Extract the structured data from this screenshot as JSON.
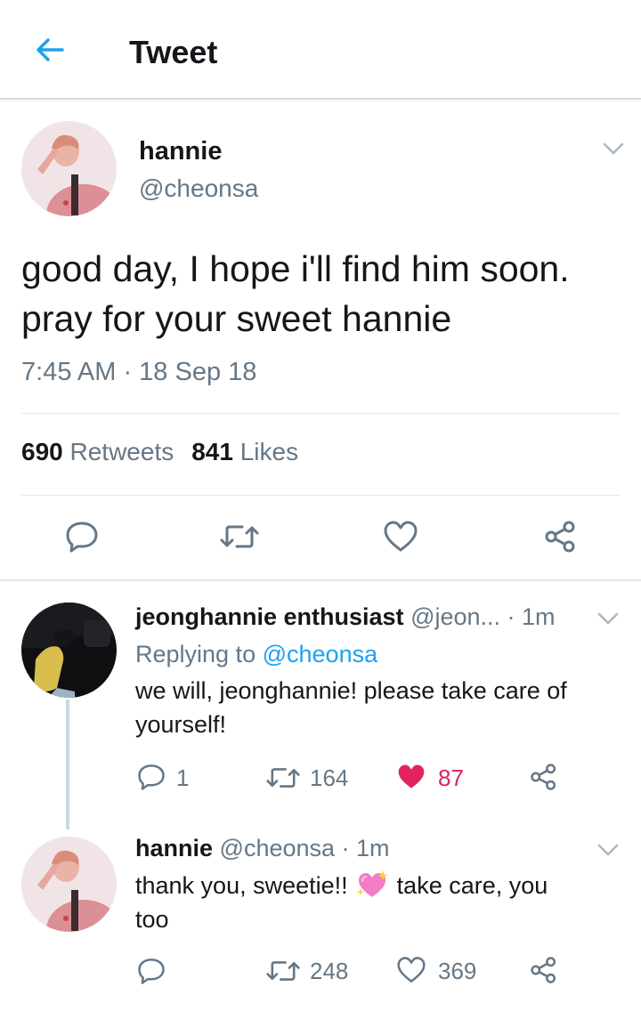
{
  "header": {
    "title": "Tweet",
    "back_icon": "arrow-left-icon",
    "accent": "#1da1f2"
  },
  "main_tweet": {
    "name": "hannie",
    "handle": "@cheonsa",
    "text_line1": "good day, I hope i'll find him soon.",
    "text_line2": "pray for your sweet hannie",
    "timestamp": "7:45 AM · 18 Sep 18",
    "retweets_count": "690",
    "retweets_label": "Retweets",
    "likes_count": "841",
    "likes_label": "Likes",
    "actions": [
      "reply-icon",
      "retweet-icon",
      "heart-icon",
      "share-icon"
    ]
  },
  "replies": [
    {
      "name": "jeonghannie enthusiast",
      "handle": "@jeon...",
      "time": "· 1m",
      "replying_prefix": "Replying to",
      "replying_handle": "@cheonsa",
      "text_line1": "we will, jeonghannie! please take care of",
      "text_line2": "yourself!",
      "reply_count": "1",
      "retweet_count": "164",
      "like_count": "87",
      "liked": true,
      "like_color": "#e0245e"
    },
    {
      "name": "hannie",
      "handle": "@cheonsa",
      "time": "· 1m",
      "text_part1": "thank you, sweetie!!",
      "emoji": "sparkling-heart-emoji",
      "text_part2": "take care, you",
      "text_line2": "too",
      "retweet_count": "248",
      "like_count": "369",
      "liked": false
    }
  ]
}
